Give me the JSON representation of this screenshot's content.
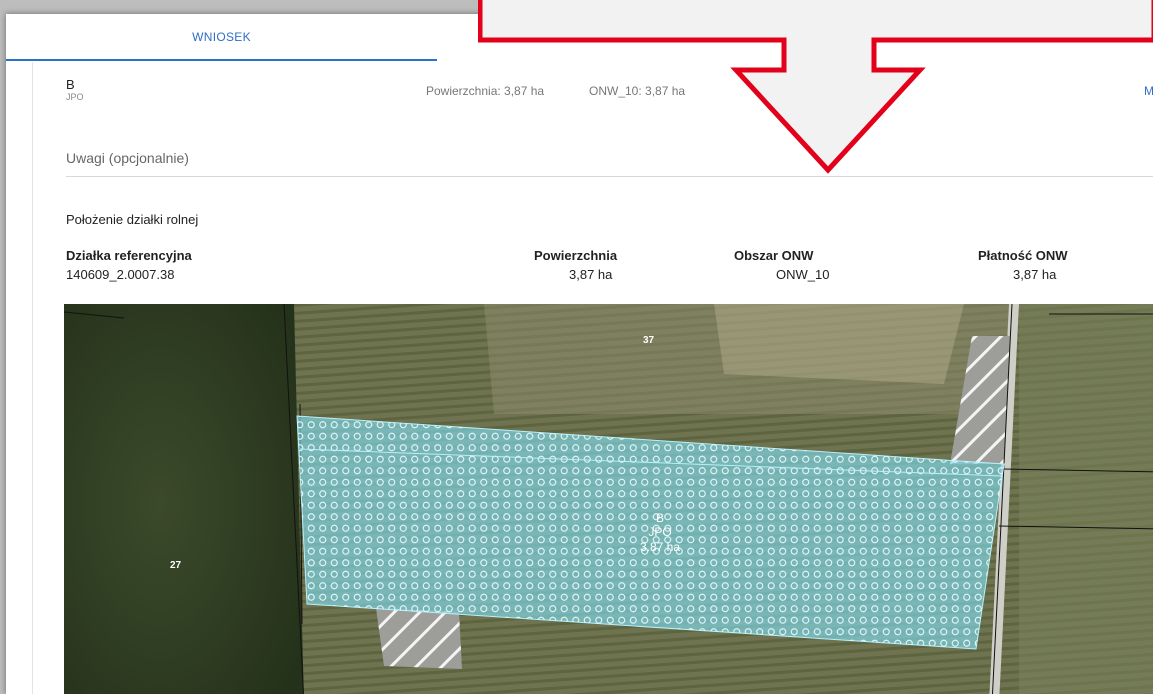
{
  "tabs": {
    "active": "WNIOSEK"
  },
  "plot": {
    "name": "B",
    "type": "JPO",
    "area_text": "Powierzchnia: 3,87 ha",
    "onw_text": "ONW_10: 3,87 ha",
    "more_label": "M"
  },
  "notes": {
    "placeholder": "Uwagi (opcjonalnie)"
  },
  "location": {
    "title": "Położenie działki rolnej",
    "columns": [
      "Działka referencyjna",
      "Powierzchnia",
      "Obszar ONW",
      "Płatność ONW"
    ],
    "row": [
      "140609_2.0007.38",
      "3,87 ha",
      "ONW_10",
      "3,87 ha"
    ]
  },
  "map": {
    "parcel_labels": [
      "37",
      "27"
    ],
    "polygon_label": {
      "name": "B",
      "type": "JPO",
      "area": "3.87 ha"
    }
  },
  "colors": {
    "accent": "#2e6fc7",
    "callout": "#e3001b",
    "polygon": "#7fd6e6"
  }
}
